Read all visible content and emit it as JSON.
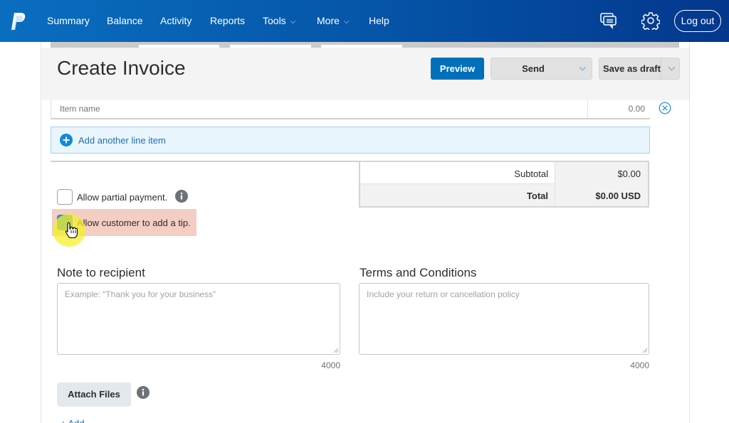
{
  "nav": {
    "items": [
      {
        "label": "Summary"
      },
      {
        "label": "Balance"
      },
      {
        "label": "Activity"
      },
      {
        "label": "Reports"
      },
      {
        "label": "Tools",
        "has_dropdown": true
      },
      {
        "label": "More",
        "has_dropdown": true
      },
      {
        "label": "Help"
      }
    ],
    "dropdown_glyph": "⌵",
    "messages_icon": "chat-icon",
    "settings_icon": "gear-icon",
    "logout_label": "Log out"
  },
  "header": {
    "title": "Create Invoice",
    "preview_label": "Preview",
    "send_label": "Send",
    "save_draft_label": "Save as draft",
    "chevron": "⌵"
  },
  "line_item": {
    "name_placeholder": "Item name",
    "amount": "0.00"
  },
  "add_line_item_label": "Add another line item",
  "totals": {
    "subtotal_label": "Subtotal",
    "subtotal_value": "$0.00",
    "total_label": "Total",
    "total_value": "$0.00 USD"
  },
  "options": {
    "partial_payment_label": "Allow partial payment.",
    "partial_payment_checked": false,
    "tip_label": "Allow customer to add a tip.",
    "tip_checked": true
  },
  "note": {
    "label": "Note to recipient",
    "placeholder": "Example: “Thank you for your business”",
    "value": "",
    "remaining": "4000"
  },
  "terms": {
    "label": "Terms and Conditions",
    "placeholder": "Include your return or cancellation policy",
    "value": "",
    "remaining": "4000"
  },
  "attach_files_label": "Attach Files",
  "bottom_link_label": "+ Add ..."
}
